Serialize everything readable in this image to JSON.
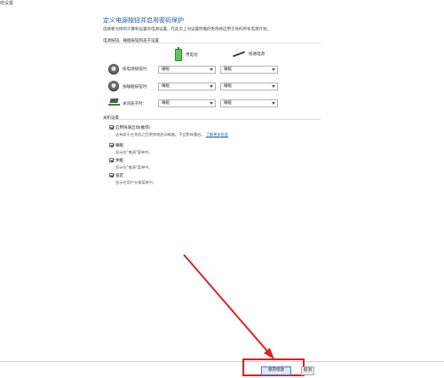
{
  "window": {
    "title": "统设置"
  },
  "page": {
    "heading": "定义电源按钮并启用密码保护",
    "description": "选择要为你的计算机设置的电源设置。在此页上对设置所做的更改将应用于你的所有电源计划。"
  },
  "power_section": {
    "label": "电源按钮、睡眠按钮和盖子设置",
    "columns": {
      "battery": "用电池",
      "plugged": "接通电源"
    },
    "rows": [
      {
        "label": "按电源按钮时:",
        "battery_value": "睡眠",
        "plugged_value": "睡眠",
        "icon": "power-button-icon"
      },
      {
        "label": "按睡眠按钮时:",
        "battery_value": "睡眠",
        "plugged_value": "睡眠",
        "icon": "sleep-button-icon"
      },
      {
        "label": "关闭盖子时:",
        "battery_value": "睡眠",
        "plugged_value": "睡眠",
        "icon": "lid-icon"
      }
    ]
  },
  "shutdown_section": {
    "label": "关机设置",
    "items": [
      {
        "label": "启用快速启动(推荐)",
        "description": "这有助于在关机之后更快地启动电脑。不会影响重启。",
        "link": "了解更多信息",
        "checked": true
      },
      {
        "label": "睡眠",
        "description": "显示在\"电源\"菜单中。",
        "checked": true
      },
      {
        "label": "休眠",
        "description": "显示在\"电源\"菜单中。",
        "checked": true
      },
      {
        "label": "锁定",
        "description": "显示在用户头像菜单中。",
        "checked": true
      }
    ]
  },
  "footer": {
    "save_label": "保存修改",
    "cancel_label": "取消"
  },
  "colors": {
    "heading": "#1f5da0",
    "link": "#1a5fb4",
    "annotation": "#e02020"
  }
}
